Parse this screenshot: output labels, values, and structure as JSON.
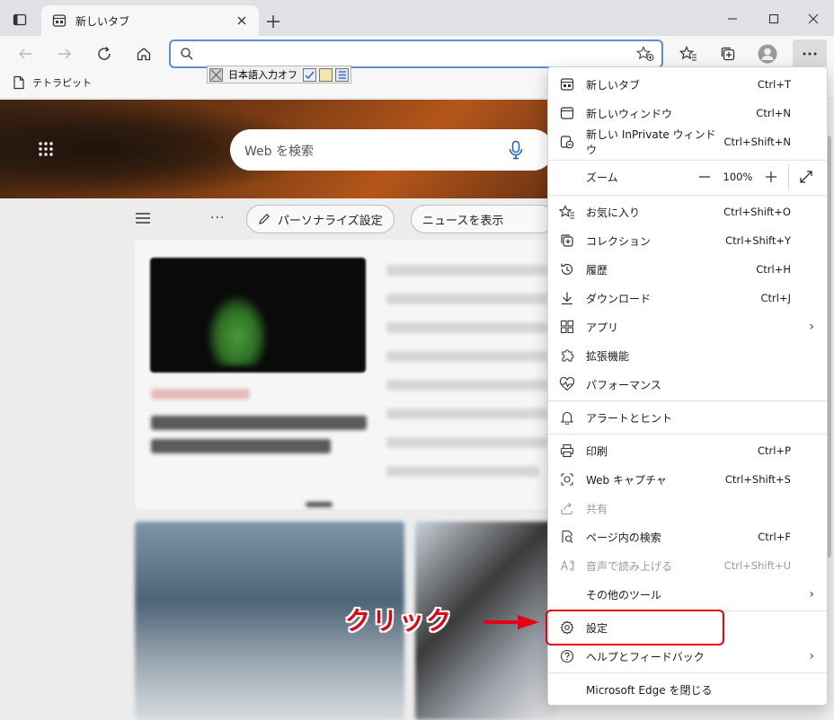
{
  "tab": {
    "title": "新しいタブ"
  },
  "address": {
    "placeholder": ""
  },
  "ime": {
    "label": "日本語入力オフ"
  },
  "favorites": {
    "items": [
      {
        "label": "テトラピット"
      }
    ]
  },
  "newtab_page": {
    "search_placeholder": "Web を検索",
    "personalize_label": "パーソナライズ設定",
    "news_label": "ニュースを表示"
  },
  "menu": {
    "items": [
      {
        "label": "新しいタブ",
        "shortcut": "Ctrl+T",
        "icon": "new-tab-icon"
      },
      {
        "label": "新しいウィンドウ",
        "shortcut": "Ctrl+N",
        "icon": "new-window-icon"
      },
      {
        "label": "新しい InPrivate ウィンドウ",
        "shortcut": "Ctrl+Shift+N",
        "icon": "inprivate-icon"
      },
      {
        "label": "ズーム",
        "shortcut": "",
        "icon": ""
      },
      {
        "label": "お気に入り",
        "shortcut": "Ctrl+Shift+O",
        "icon": "favorites-icon"
      },
      {
        "label": "コレクション",
        "shortcut": "Ctrl+Shift+Y",
        "icon": "collections-icon"
      },
      {
        "label": "履歴",
        "shortcut": "Ctrl+H",
        "icon": "history-icon"
      },
      {
        "label": "ダウンロード",
        "shortcut": "Ctrl+J",
        "icon": "download-icon"
      },
      {
        "label": "アプリ",
        "shortcut": "",
        "icon": "apps-icon"
      },
      {
        "label": "拡張機能",
        "shortcut": "",
        "icon": "extensions-icon"
      },
      {
        "label": "パフォーマンス",
        "shortcut": "",
        "icon": "performance-icon"
      },
      {
        "label": "アラートとヒント",
        "shortcut": "",
        "icon": "bell-icon"
      },
      {
        "label": "印刷",
        "shortcut": "Ctrl+P",
        "icon": "print-icon"
      },
      {
        "label": "Web キャプチャ",
        "shortcut": "Ctrl+Shift+S",
        "icon": "web-capture-icon"
      },
      {
        "label": "共有",
        "shortcut": "",
        "icon": "share-icon"
      },
      {
        "label": "ページ内の検索",
        "shortcut": "Ctrl+F",
        "icon": "find-icon"
      },
      {
        "label": "音声で読み上げる",
        "shortcut": "Ctrl+Shift+U",
        "icon": "read-aloud-icon"
      },
      {
        "label": "その他のツール",
        "shortcut": "",
        "icon": ""
      },
      {
        "label": "設定",
        "shortcut": "",
        "icon": "gear-icon"
      },
      {
        "label": "ヘルプとフィードバック",
        "shortcut": "",
        "icon": "help-icon"
      },
      {
        "label": "Microsoft Edge を閉じる",
        "shortcut": "",
        "icon": ""
      }
    ],
    "zoom_value": "100%"
  },
  "annotation": {
    "text": "クリック"
  }
}
